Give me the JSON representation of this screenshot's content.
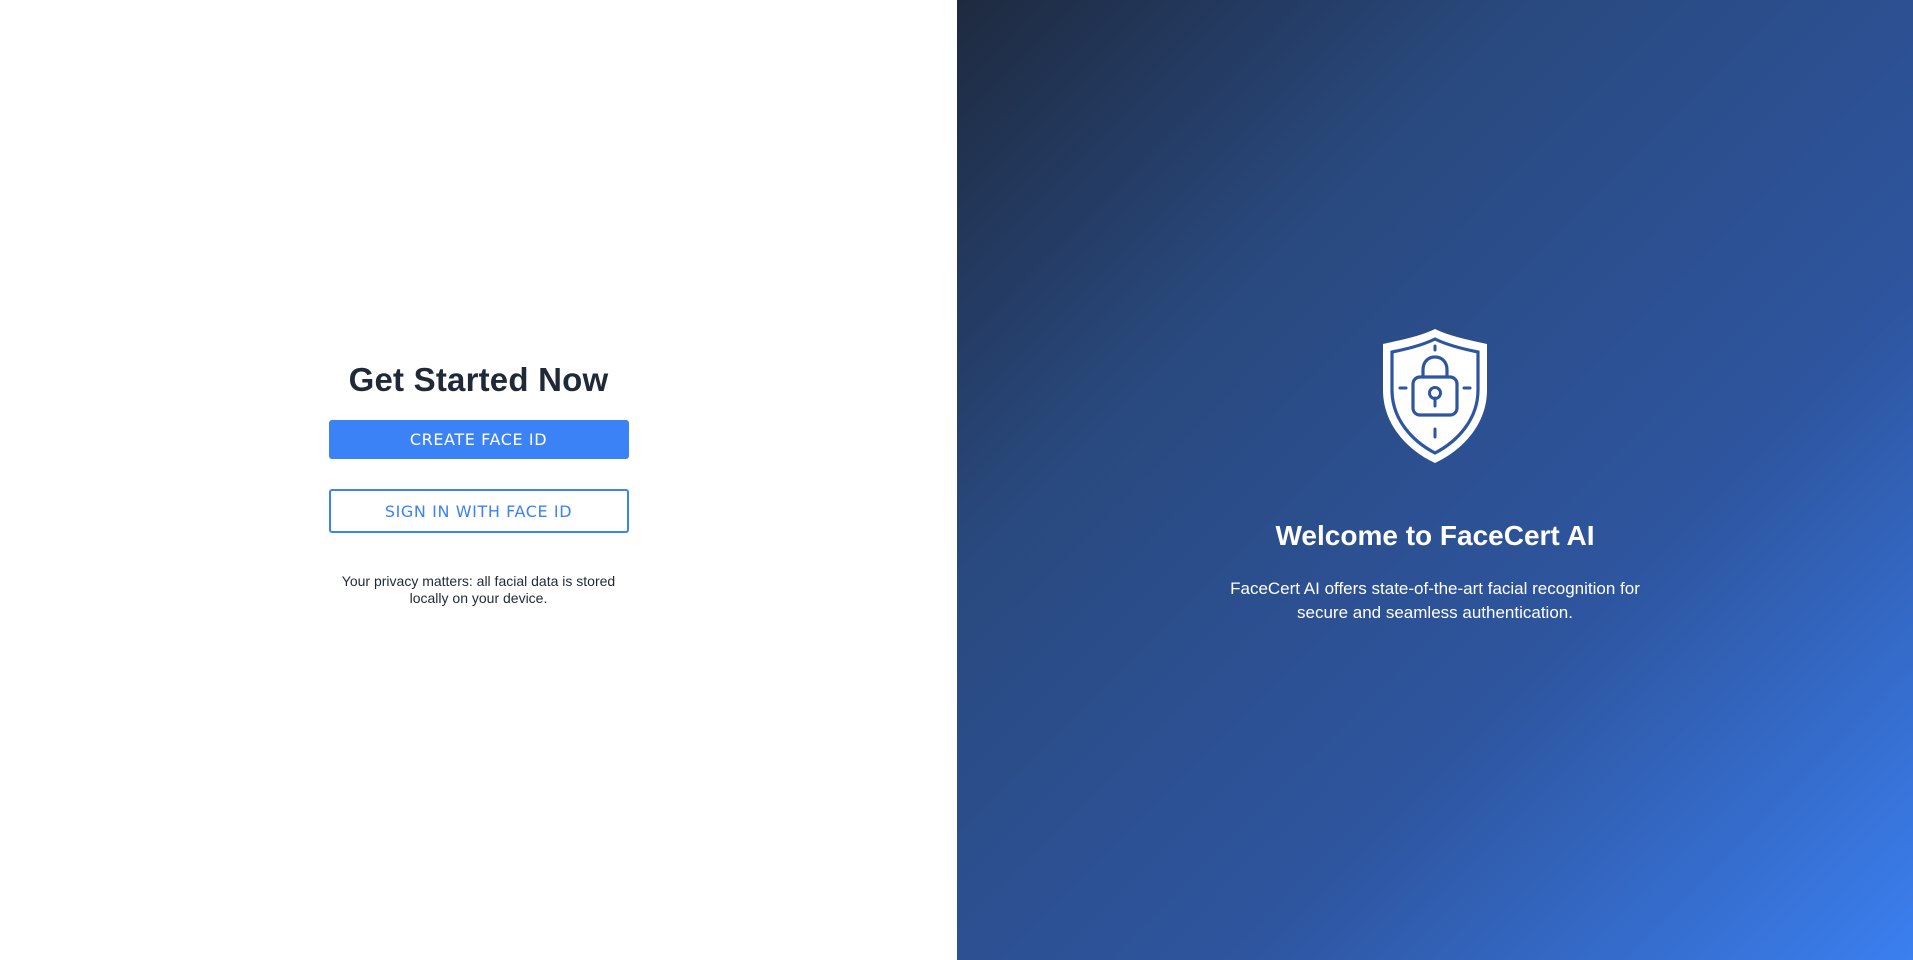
{
  "left": {
    "title": "Get Started Now",
    "create_button_label": "CREATE FACE ID",
    "signin_button_label": "SIGN IN WITH FACE ID",
    "privacy_note": "Your privacy matters: all facial data is stored locally on your device."
  },
  "right": {
    "icon": "shield-lock-icon",
    "heading": "Welcome to FaceCert AI",
    "description": "FaceCert AI offers state-of-the-art facial recognition for secure and seamless authentication."
  },
  "colors": {
    "accent": "#3b82f6",
    "title_text": "#1f2937",
    "gradient_start": "#1e2a3f",
    "gradient_end": "#3b7ff0"
  }
}
